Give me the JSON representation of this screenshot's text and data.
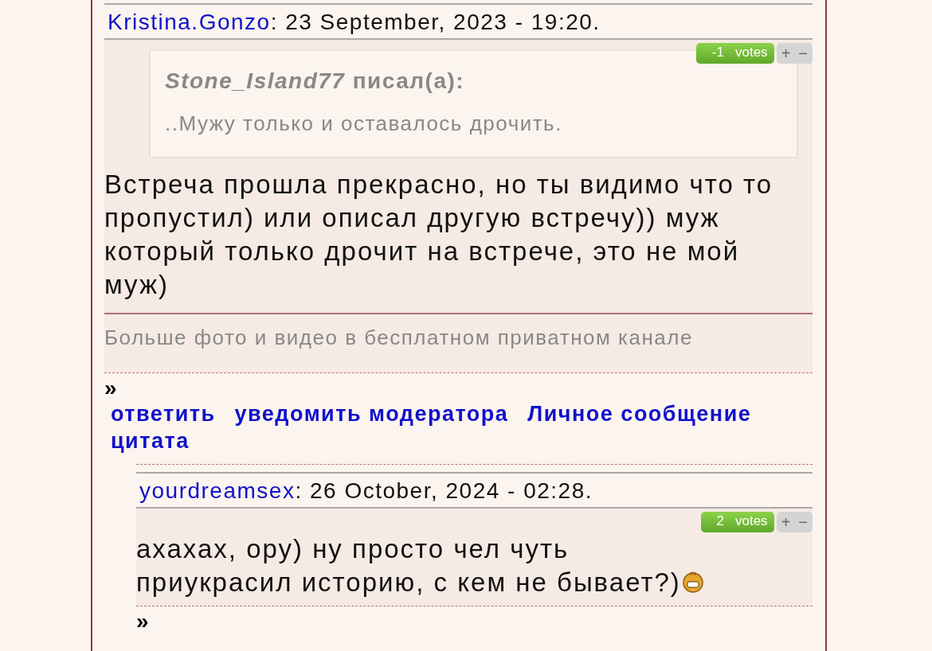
{
  "posts": [
    {
      "author": "Kristina.Gonzo",
      "date": ": 23 September, 2023 - 19:20.",
      "votes": {
        "count": "-1",
        "label": "votes",
        "plus": "+",
        "minus": "−"
      },
      "quote": {
        "author": "Stone_Island77",
        "said": "писал(а):",
        "text": "..Мужу только и оставалось дрочить."
      },
      "body": "Встреча прошла прекрасно, но ты видимо что то пропустил) или описал другую встречу)) муж который только дрочит на встрече, это не мой муж)",
      "signature": "Больше фото и видео в бесплатном приватном канале",
      "marker": "»",
      "actions": [
        "ответить",
        "уведомить модератора",
        "Личное сообщение",
        "цитата"
      ]
    },
    {
      "author": "yourdreamsex",
      "date": ": 26 October, 2024 - 02:28.",
      "votes": {
        "count": "2",
        "label": "votes",
        "plus": "+",
        "minus": "−"
      },
      "body": "ахахах, ору) ну просто чел чуть приукрасил историю, с кем не бывает?)",
      "emoji": true,
      "marker": "»"
    }
  ]
}
